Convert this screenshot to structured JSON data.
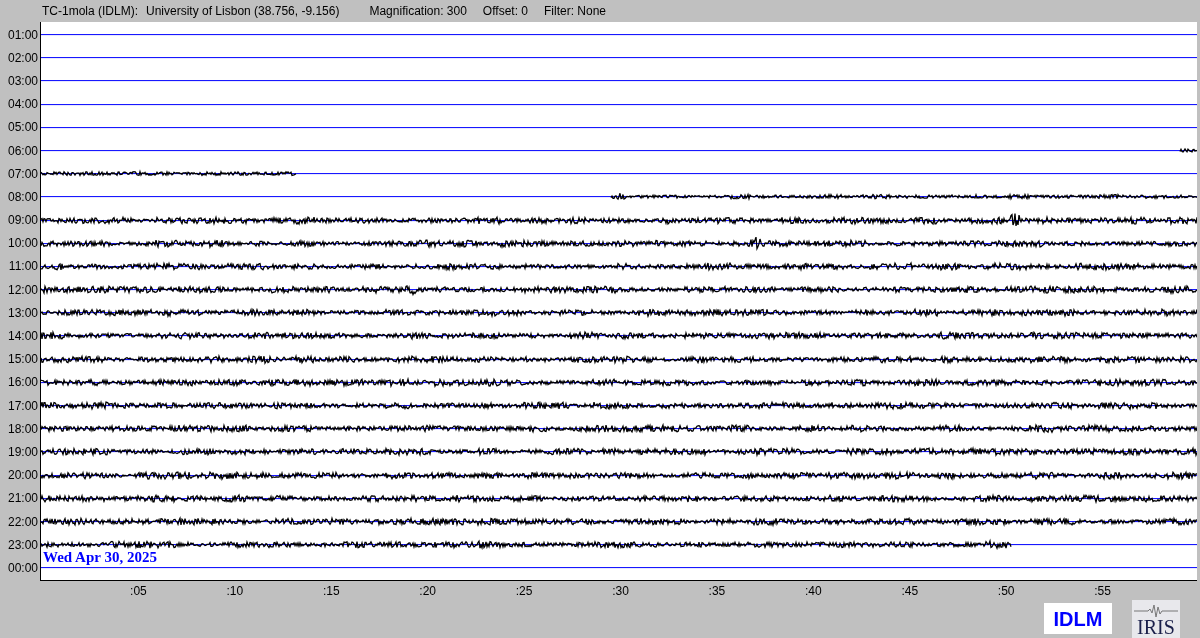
{
  "header": {
    "station": "TC-1mola (IDLM):",
    "location": "University of Lisbon (38.756, -9.156)",
    "magnification": "Magnification: 300",
    "offset": "Offset: 0",
    "filter": "Filter: None"
  },
  "rows": [
    {
      "label": "01:00",
      "kind": "empty"
    },
    {
      "label": "02:00",
      "kind": "empty"
    },
    {
      "label": "03:00",
      "kind": "empty"
    },
    {
      "label": "04:00",
      "kind": "empty"
    },
    {
      "label": "05:00",
      "kind": "empty"
    },
    {
      "label": "06:00",
      "kind": "partial"
    },
    {
      "label": "07:00",
      "kind": "partial"
    },
    {
      "label": "08:00",
      "kind": "partial"
    },
    {
      "label": "09:00",
      "kind": "full"
    },
    {
      "label": "10:00",
      "kind": "full"
    },
    {
      "label": "11:00",
      "kind": "full"
    },
    {
      "label": "12:00",
      "kind": "full"
    },
    {
      "label": "13:00",
      "kind": "full"
    },
    {
      "label": "14:00",
      "kind": "full"
    },
    {
      "label": "15:00",
      "kind": "full"
    },
    {
      "label": "16:00",
      "kind": "full"
    },
    {
      "label": "17:00",
      "kind": "full"
    },
    {
      "label": "18:00",
      "kind": "full"
    },
    {
      "label": "19:00",
      "kind": "full"
    },
    {
      "label": "20:00",
      "kind": "full"
    },
    {
      "label": "21:00",
      "kind": "full"
    },
    {
      "label": "22:00",
      "kind": "full"
    },
    {
      "label": "23:00",
      "kind": "partial"
    },
    {
      "label": "00:00",
      "kind": "empty"
    }
  ],
  "date_label": "Wed Apr 30, 2025",
  "x_ticks": [
    ":05",
    ":10",
    ":15",
    ":20",
    ":25",
    ":30",
    ":35",
    ":40",
    ":45",
    ":50",
    ":55"
  ],
  "logos": [
    {
      "kind": "idlm",
      "text": "IDLM"
    },
    {
      "kind": "iris",
      "text": "IRIS"
    }
  ]
}
